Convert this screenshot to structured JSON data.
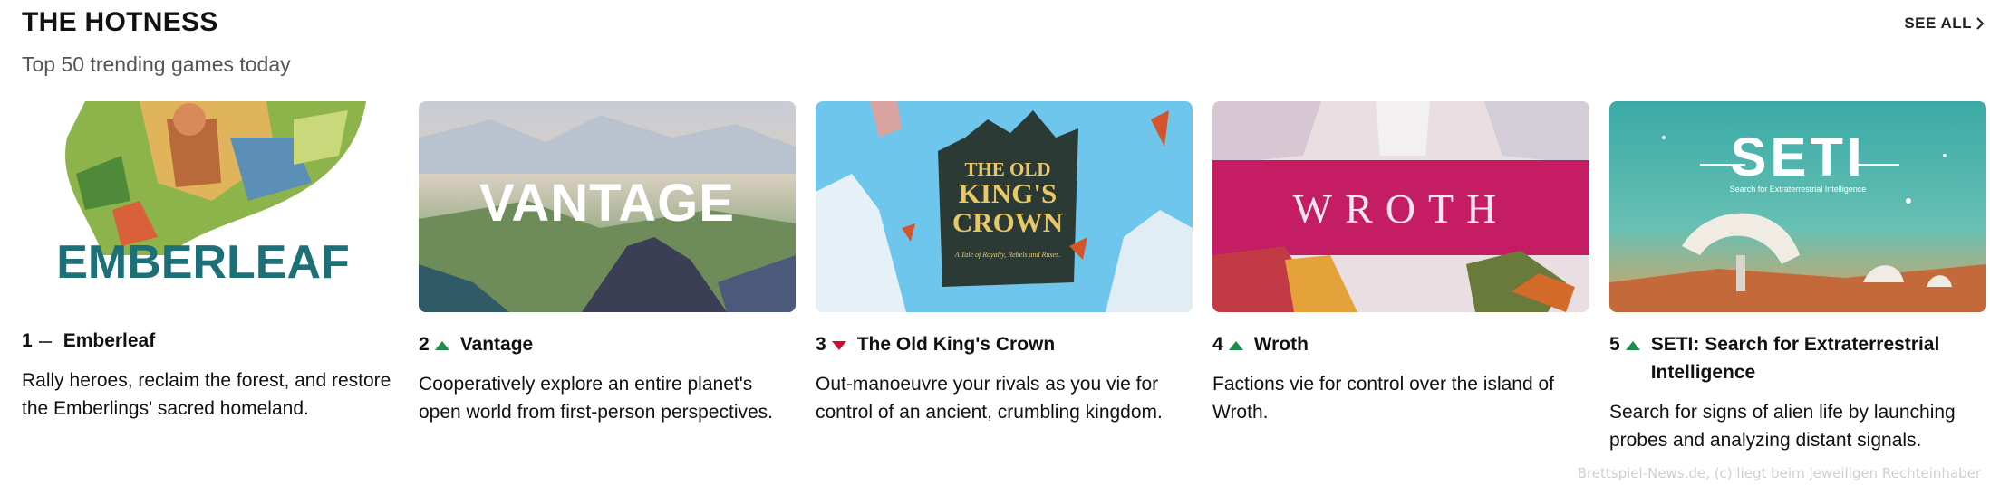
{
  "section": {
    "title": "THE HOTNESS",
    "subtitle": "Top 50 trending games today",
    "see_all_label": "SEE ALL"
  },
  "games": [
    {
      "rank": "1",
      "trend": "same",
      "title": "Emberleaf",
      "logo_text": "EMBERLEAF",
      "description": "Rally heroes, reclaim the forest, and restore the Emberlings' sacred homeland."
    },
    {
      "rank": "2",
      "trend": "up",
      "title": "Vantage",
      "logo_text": "VANTAGE",
      "description": "Cooperatively explore an entire planet's open world from first-person perspectives."
    },
    {
      "rank": "3",
      "trend": "down",
      "title": "The Old King's Crown",
      "logo_text": "THE OLD KING'S CROWN",
      "logo_subtext": "A Tale of Royalty, Rebels and Ruses.",
      "description": "Out-manoeuvre your rivals as you vie for control of an ancient, crumbling kingdom."
    },
    {
      "rank": "4",
      "trend": "up",
      "title": "Wroth",
      "logo_text": "WROTH",
      "description": "Factions vie for control over the island of Wroth."
    },
    {
      "rank": "5",
      "trend": "up",
      "title": "SETI: Search for Extraterrestrial Intelligence",
      "logo_text": "SETI",
      "logo_subtext": "Search for Extraterrestrial Intelligence",
      "description": "Search for signs of alien life by launching probes and analyzing distant signals."
    }
  ],
  "colors": {
    "trend_up": "#1e8a4c",
    "trend_down": "#c8102e",
    "trend_same": "#444444"
  },
  "watermark": "Brettspiel-News.de, (c) liegt beim jeweiligen Rechteinhaber"
}
